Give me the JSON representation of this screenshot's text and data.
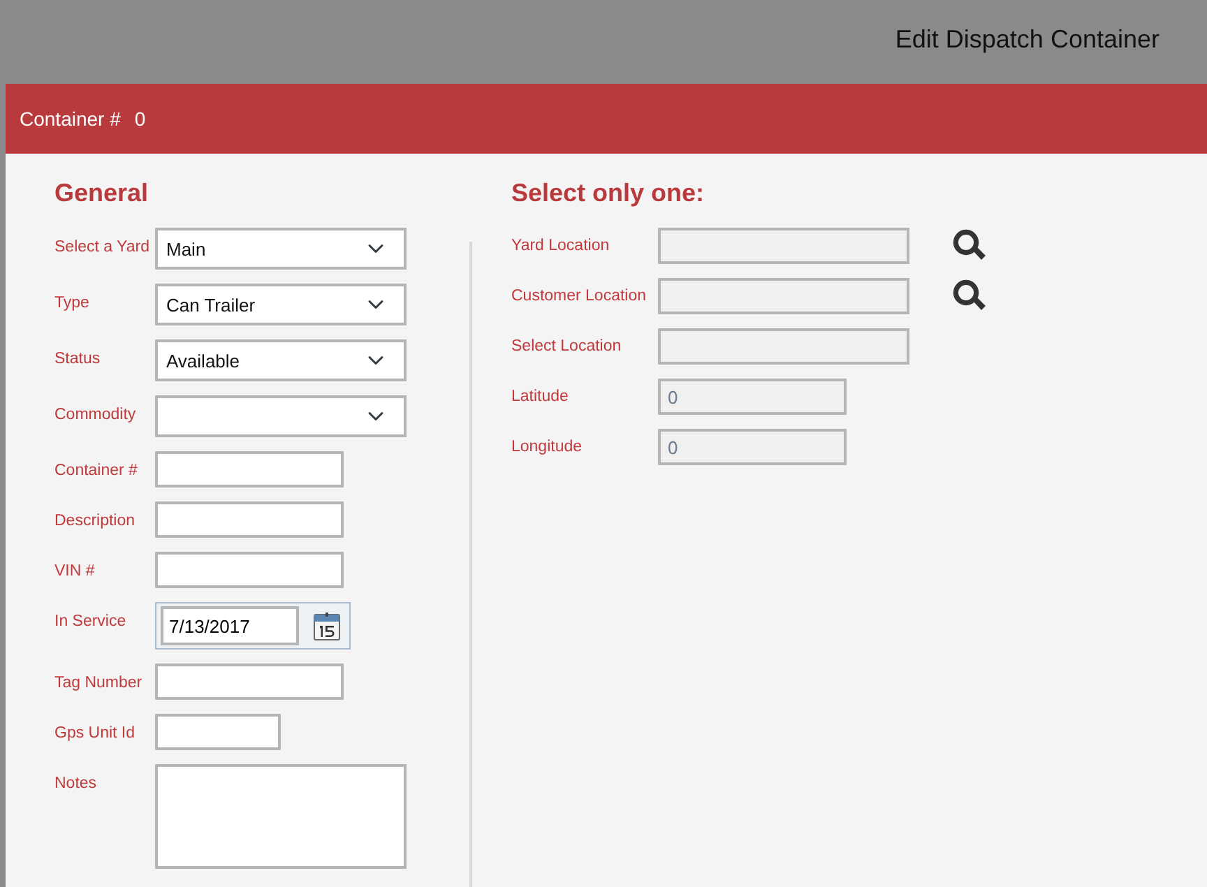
{
  "title": "Edit Dispatch Container",
  "header": {
    "label": "Container #",
    "value": "0"
  },
  "general": {
    "heading": "General",
    "fields": [
      {
        "kind": "select",
        "label": "Select a Yard",
        "value": "Main"
      },
      {
        "kind": "select",
        "label": "Type",
        "value": "Can Trailer"
      },
      {
        "kind": "select",
        "label": "Status",
        "value": "Available"
      },
      {
        "kind": "select",
        "label": "Commodity"
      },
      {
        "kind": "text",
        "label": "Container #"
      },
      {
        "kind": "text",
        "label": "Description"
      },
      {
        "kind": "text",
        "label": "VIN #"
      },
      {
        "kind": "date",
        "label": "In Service",
        "value": "7/13/2017"
      },
      {
        "kind": "text",
        "label": "Tag Number"
      },
      {
        "kind": "short",
        "label": "Gps Unit Id"
      },
      {
        "kind": "notes",
        "label": "Notes"
      }
    ]
  },
  "location": {
    "heading": "Select only one:",
    "fields": [
      {
        "kind": "location",
        "label": "Yard Location",
        "search_button": true
      },
      {
        "kind": "location",
        "label": "Customer Location",
        "search_button": true
      },
      {
        "kind": "location",
        "label": "Select Location",
        "search_button": false
      },
      {
        "kind": "coordinate",
        "label": "Latitude",
        "value": "0",
        "search_button": false
      },
      {
        "kind": "coordinate",
        "label": "Longitude",
        "value": "0",
        "search_button": false
      }
    ]
  }
}
